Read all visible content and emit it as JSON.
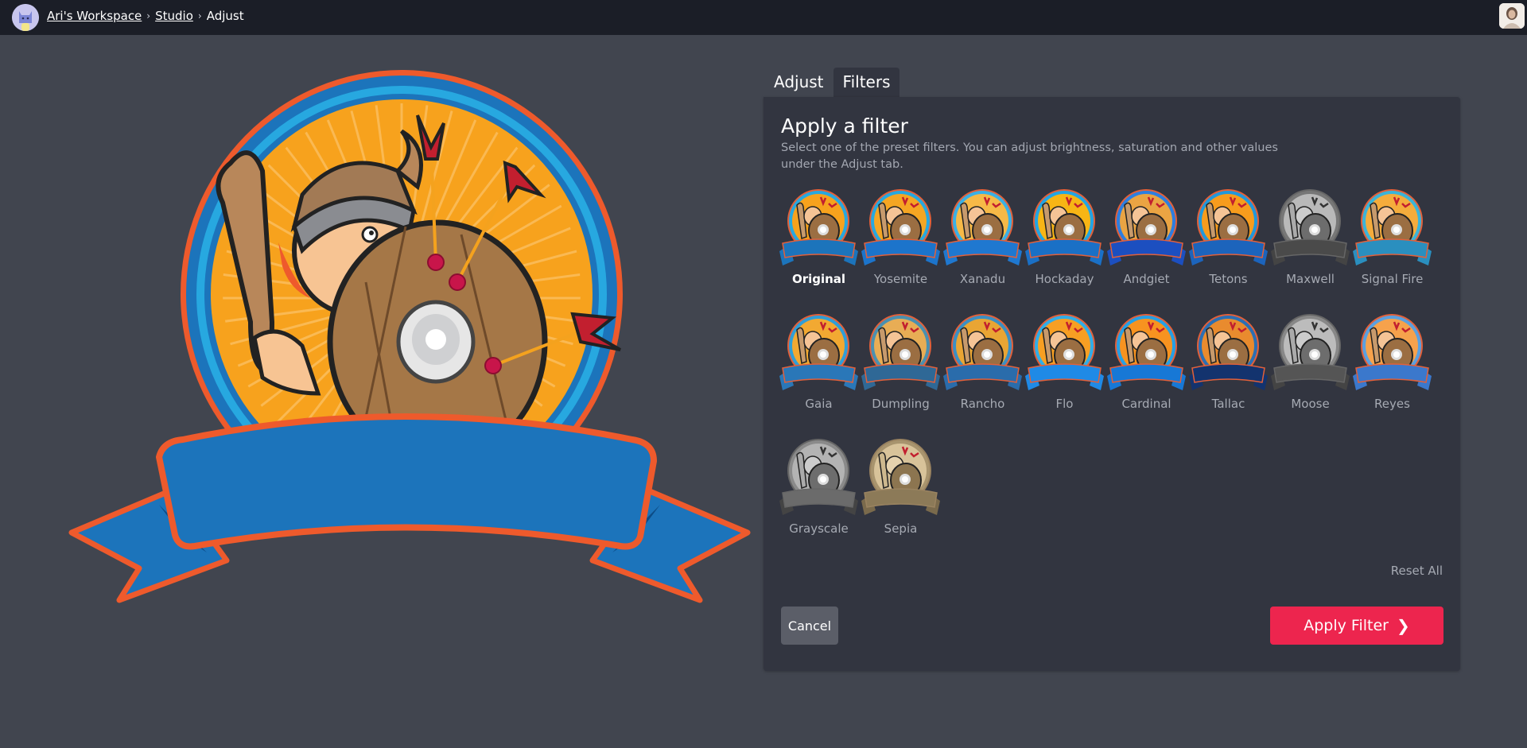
{
  "topbar": {
    "workspace_avatar_icon": "cat-avatar-icon",
    "breadcrumb": [
      {
        "label": "Ari's Workspace",
        "link": true
      },
      {
        "label": "Studio",
        "link": true
      },
      {
        "label": "Adjust",
        "link": false
      }
    ],
    "separator": "›",
    "user_avatar_icon": "user-photo-avatar"
  },
  "canvas": {
    "image_description": "Viking warrior badge with shield, arrows and blank blue ribbon banner",
    "colors": {
      "outer_ring": "#ee5a2c",
      "blue_ring": "#1c74bb",
      "light_ring": "#27a8e0",
      "sunburst": "#f7a21d",
      "banner": "#1c74bb",
      "shield": "#a57747"
    }
  },
  "tabs": [
    {
      "label": "Adjust",
      "active": false
    },
    {
      "label": "Filters",
      "active": true
    }
  ],
  "panel": {
    "title": "Apply a filter",
    "description": "Select one of the preset filters. You can adjust brightness, saturation and other values under the Adjust tab.",
    "filters": [
      {
        "label": "Original",
        "selected": true,
        "banner": "#1c74bb",
        "sun": "#f7a21d",
        "ring": "#27a8e0",
        "tone": "color"
      },
      {
        "label": "Yosemite",
        "selected": false,
        "banner": "#1c74cb",
        "sun": "#f5a623",
        "ring": "#27a8e0",
        "tone": "color"
      },
      {
        "label": "Xanadu",
        "selected": false,
        "banner": "#1f78d0",
        "sun": "#f6b947",
        "ring": "#3ab0e6",
        "tone": "color"
      },
      {
        "label": "Hockaday",
        "selected": false,
        "banner": "#1a70c6",
        "sun": "#f7b515",
        "ring": "#22a5e4",
        "tone": "color"
      },
      {
        "label": "Andgiet",
        "selected": false,
        "banner": "#1c4fc0",
        "sun": "#eaa443",
        "ring": "#2d7ee0",
        "tone": "color"
      },
      {
        "label": "Tetons",
        "selected": false,
        "banner": "#1c64bc",
        "sun": "#f79c1d",
        "ring": "#2198dc",
        "tone": "color"
      },
      {
        "label": "Maxwell",
        "selected": false,
        "banner": "#4a4a4a",
        "sun": "#b9b9b9",
        "ring": "#777777",
        "tone": "gray"
      },
      {
        "label": "Signal Fire",
        "selected": false,
        "banner": "#2a8fbf",
        "sun": "#f5ac3c",
        "ring": "#3bb4d9",
        "tone": "color"
      },
      {
        "label": "Gaia",
        "selected": false,
        "banner": "#2a77b8",
        "sun": "#f2a932",
        "ring": "#2f9ed8",
        "tone": "color"
      },
      {
        "label": "Dumpling",
        "selected": false,
        "banner": "#2f6896",
        "sun": "#e8ad55",
        "ring": "#4a90b0",
        "tone": "color"
      },
      {
        "label": "Rancho",
        "selected": false,
        "banner": "#2a6cab",
        "sun": "#e9a534",
        "ring": "#3b8fc4",
        "tone": "color"
      },
      {
        "label": "Flo",
        "selected": false,
        "banner": "#1f8ae6",
        "sun": "#f79f23",
        "ring": "#30ade8",
        "tone": "color"
      },
      {
        "label": "Cardinal",
        "selected": false,
        "banner": "#1778d6",
        "sun": "#f79320",
        "ring": "#25a0e6",
        "tone": "color"
      },
      {
        "label": "Tallac",
        "selected": false,
        "banner": "#13336e",
        "sun": "#e98b2e",
        "ring": "#2b6fb4",
        "tone": "color"
      },
      {
        "label": "Moose",
        "selected": false,
        "banner": "#555555",
        "sun": "#bcbcbc",
        "ring": "#888888",
        "tone": "gray"
      },
      {
        "label": "Reyes",
        "selected": false,
        "banner": "#3b78cc",
        "sun": "#f6a24c",
        "ring": "#5aa0e0",
        "tone": "color"
      },
      {
        "label": "Grayscale",
        "selected": false,
        "banner": "#6b6b6b",
        "sun": "#b3b3b3",
        "ring": "#8a8a8a",
        "tone": "gray"
      },
      {
        "label": "Sepia",
        "selected": false,
        "banner": "#8c7a58",
        "sun": "#d8c39a",
        "ring": "#a8946e",
        "tone": "sepia"
      }
    ],
    "reset_label": "Reset All",
    "cancel_label": "Cancel",
    "apply_label": "Apply Filter",
    "apply_icon": "chevron-right-icon",
    "apply_color": "#ed254e"
  }
}
